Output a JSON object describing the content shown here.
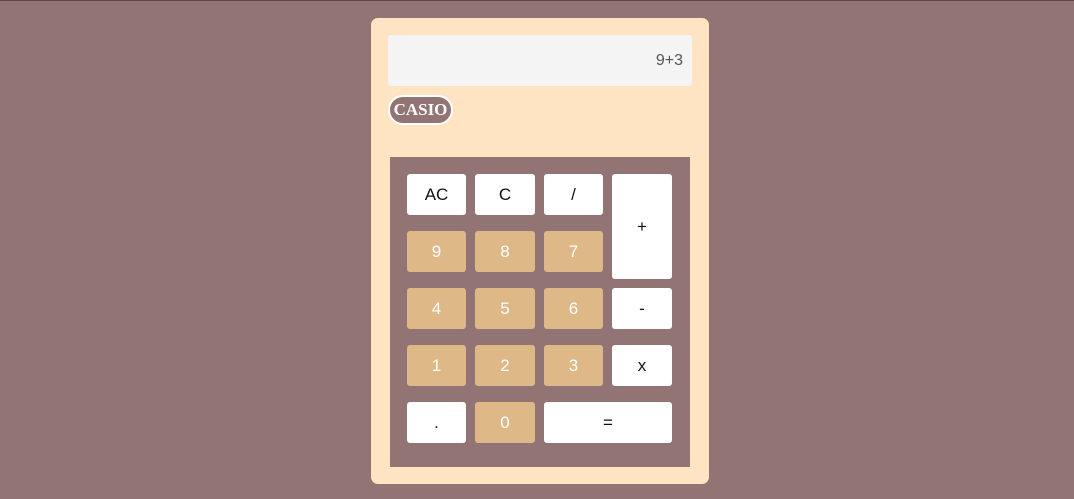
{
  "display": {
    "value": "9+3"
  },
  "brand": {
    "label": "CASIO"
  },
  "keys": {
    "ac": "AC",
    "c": "C",
    "divide": "/",
    "plus": "+",
    "nine": "9",
    "eight": "8",
    "seven": "7",
    "four": "4",
    "five": "5",
    "six": "6",
    "minus": "-",
    "one": "1",
    "two": "2",
    "three": "3",
    "multiply": "x",
    "dot": ".",
    "zero": "0",
    "equals": "="
  },
  "colors": {
    "background": "#927474",
    "body": "#ffe4c4",
    "display": "#f4f4f4",
    "number_key": "#deb887",
    "operator_key": "#ffffff"
  }
}
